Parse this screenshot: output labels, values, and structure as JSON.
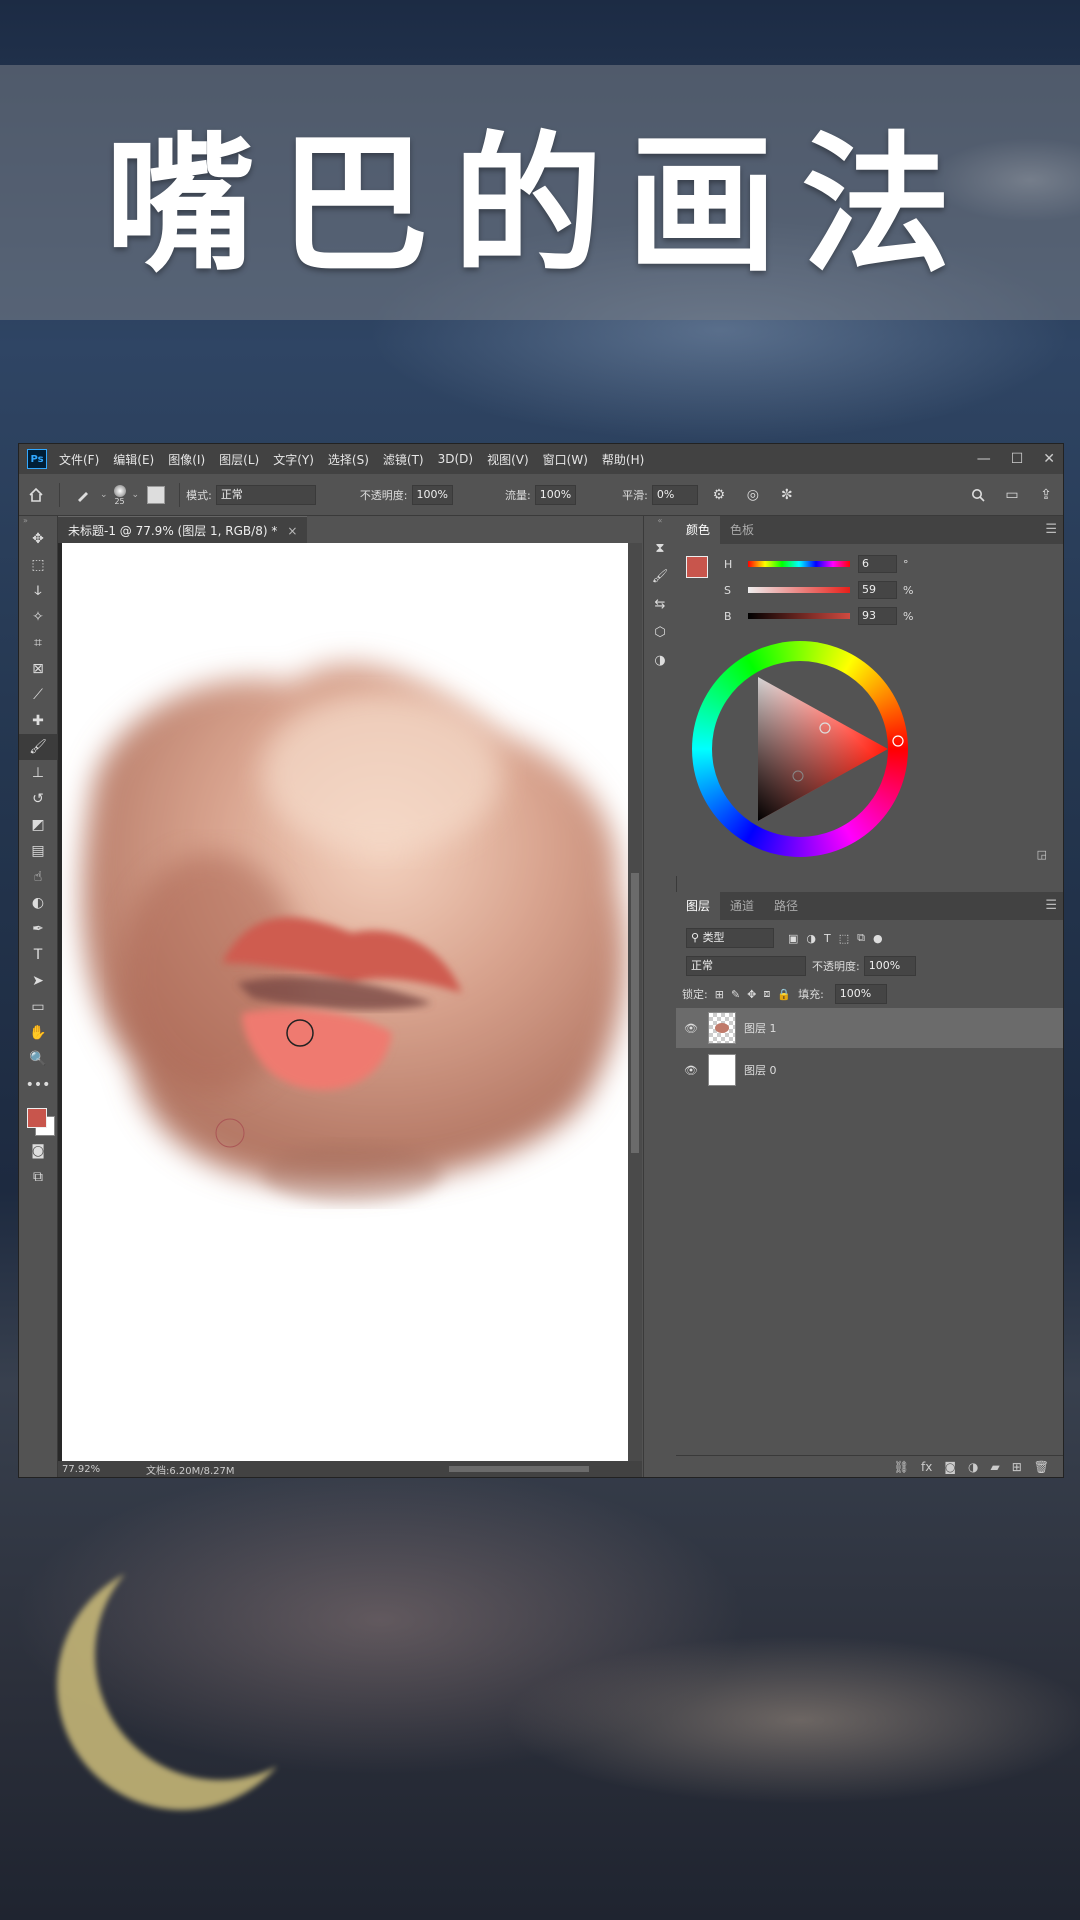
{
  "title": "嘴巴的画法",
  "photoshop": {
    "logo": "Ps",
    "menu": [
      "文件(F)",
      "编辑(E)",
      "图像(I)",
      "图层(L)",
      "文字(Y)",
      "选择(S)",
      "滤镜(T)",
      "3D(D)",
      "视图(V)",
      "窗口(W)",
      "帮助(H)"
    ],
    "window_buttons": {
      "minimize": "—",
      "maximize": "☐",
      "close": "✕"
    },
    "options": {
      "brush_size": "25",
      "mode_label": "模式:",
      "mode_value": "正常",
      "opacity_label": "不透明度:",
      "opacity_value": "100%",
      "flow_label": "流量:",
      "flow_value": "100%",
      "smooth_label": "平滑:",
      "smooth_value": "0%"
    },
    "document_tab": {
      "title": "未标题-1 @ 77.9% (图层 1, RGB/8) *",
      "close": "×"
    },
    "status": {
      "zoom": "77.92%",
      "doc": "文档:6.20M/8.27M"
    },
    "color_panel": {
      "tabs": [
        "颜色",
        "色板"
      ],
      "foreground_color": "#c8554c",
      "h_label": "H",
      "h_value": "6",
      "h_unit": "°",
      "s_label": "S",
      "s_value": "59",
      "s_unit": "%",
      "b_label": "B",
      "b_value": "93",
      "b_unit": "%"
    },
    "layers_panel": {
      "tabs": [
        "图层",
        "通道",
        "路径"
      ],
      "filter_kind": "类型",
      "blend_mode": "正常",
      "opacity_label": "不透明度:",
      "opacity_value": "100%",
      "lock_label": "锁定:",
      "fill_label": "填充:",
      "fill_value": "100%",
      "layers": [
        {
          "name": "图层 1",
          "selected": true
        },
        {
          "name": "图层 0",
          "selected": false
        }
      ],
      "bottom_icons": [
        "link-icon",
        "fx-icon",
        "mask-icon",
        "adjustment-icon",
        "folder-icon",
        "new-layer-icon",
        "trash-icon"
      ]
    }
  }
}
